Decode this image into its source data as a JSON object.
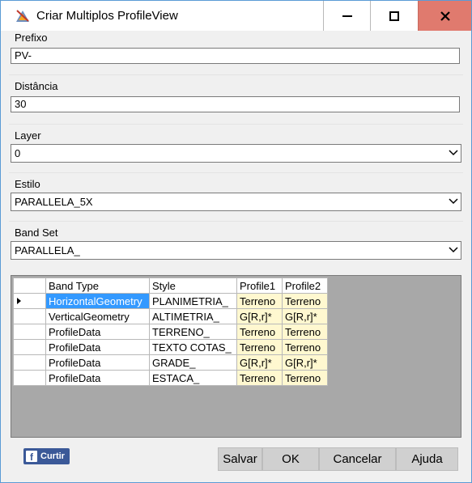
{
  "window": {
    "title": "Criar Multiplos ProfileView"
  },
  "prefixo": {
    "label": "Prefixo",
    "value": "PV-"
  },
  "distancia": {
    "label": "Distância",
    "value": "30"
  },
  "layer": {
    "label": "Layer",
    "value": "0"
  },
  "estilo": {
    "label": "Estilo",
    "value": "PARALLELA_5X"
  },
  "band_set": {
    "label": "Band Set",
    "value": "PARALLELA_"
  },
  "table": {
    "headers": [
      "Band Type",
      "Style",
      "Profile1",
      "Profile2"
    ],
    "rows": [
      [
        "HorizontalGeometry",
        "PLANIMETRIA_",
        "Terreno",
        "Terreno"
      ],
      [
        "VerticalGeometry",
        "ALTIMETRIA_",
        "G[R,r]*",
        "G[R,r]*"
      ],
      [
        "ProfileData",
        "TERRENO_",
        "Terreno",
        "Terreno"
      ],
      [
        "ProfileData",
        "TEXTO COTAS_",
        "Terreno",
        "Terreno"
      ],
      [
        "ProfileData",
        "GRADE_",
        "G[R,r]*",
        "G[R,r]*"
      ],
      [
        "ProfileData",
        "ESTACA_",
        "Terreno",
        "Terreno"
      ]
    ]
  },
  "share": {
    "label": "Curtir"
  },
  "buttons": {
    "salvar": "Salvar",
    "ok": "OK",
    "cancelar": "Cancelar",
    "ajuda": "Ajuda"
  },
  "colors": {
    "close_button": "#e07a6e",
    "selection": "#3399ff",
    "profile_cell": "#fff8d0",
    "grid_background": "#a8a8a8",
    "facebook": "#3b5998"
  }
}
